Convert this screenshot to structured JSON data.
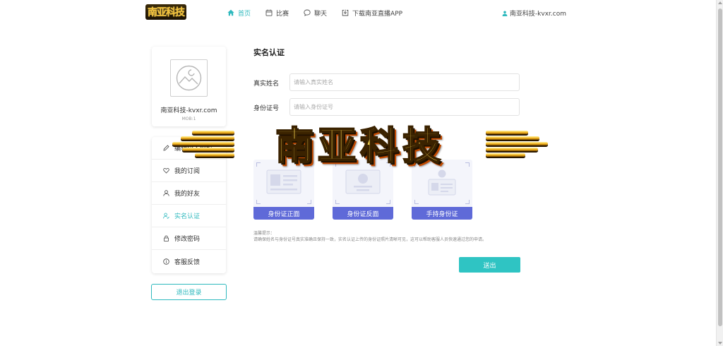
{
  "header": {
    "logo_text": "南亚科技",
    "nav": [
      {
        "label": "首页",
        "icon": "home-icon",
        "active": true
      },
      {
        "label": "比赛",
        "icon": "calendar-icon",
        "active": false
      },
      {
        "label": "聊天",
        "icon": "chat-icon",
        "active": false
      },
      {
        "label": "下载南亚直播APP",
        "icon": "download-icon",
        "active": false
      }
    ],
    "user_label": "南亚科技-kvxr.com"
  },
  "profile": {
    "name": "南亚科技-kvxr.com",
    "sub": "MOB:1"
  },
  "menu": [
    {
      "label": "编辑个人资料",
      "icon": "pencil-icon",
      "active": false
    },
    {
      "label": "我的订阅",
      "icon": "heart-icon",
      "active": false
    },
    {
      "label": "我的好友",
      "icon": "user-icon",
      "active": false
    },
    {
      "label": "实名认证",
      "icon": "user-check-icon",
      "active": true
    },
    {
      "label": "修改密码",
      "icon": "lock-icon",
      "active": false
    },
    {
      "label": "客服反馈",
      "icon": "info-icon",
      "active": false
    }
  ],
  "logout_label": "退出登录",
  "form": {
    "title": "实名认证",
    "name_label": "真实姓名",
    "name_placeholder": "请输入真实姓名",
    "id_label": "身份证号",
    "id_placeholder": "请输入身份证号",
    "cards": [
      "身份证正面",
      "身份证反面",
      "手持身份证"
    ],
    "tip_title": "温馨提示：",
    "tip_text": "请确保姓名与身份证号真实准确且保持一致，实名认证上传的身份证照片清晰可见，这可以帮助客服人员快速通过您的申请。",
    "submit_label": "送出"
  },
  "watermark": {
    "text": "南亚科技"
  },
  "colors": {
    "accent": "#2fb9be",
    "card_bar": "#5f6ad8",
    "submit": "#2fc4c3"
  }
}
